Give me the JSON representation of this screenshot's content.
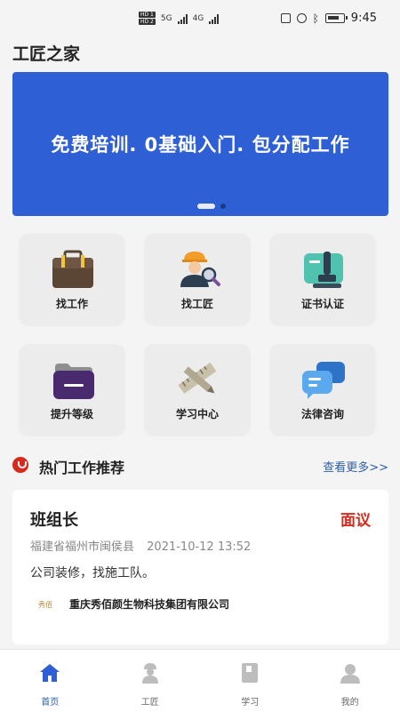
{
  "status_bar": {
    "hd1": "HD 1",
    "hd2": "HD 2",
    "net1": "5G",
    "net2": "4G",
    "time": "9:45"
  },
  "header": {
    "title": "工匠之家"
  },
  "banner": {
    "text": "免费培训. 0基础入门. 包分配工作"
  },
  "menu": [
    {
      "label": "找工作",
      "icon": "briefcase-icon"
    },
    {
      "label": "找工匠",
      "icon": "worker-search-icon"
    },
    {
      "label": "证书认证",
      "icon": "certificate-stamp-icon"
    },
    {
      "label": "提升等级",
      "icon": "folder-icon"
    },
    {
      "label": "学习中心",
      "icon": "ruler-pencil-icon"
    },
    {
      "label": "法律咨询",
      "icon": "chat-bubbles-icon"
    }
  ],
  "section": {
    "title": "热门工作推荐",
    "more": "查看更多>>"
  },
  "job": {
    "title": "班组长",
    "salary": "面议",
    "location": "福建省福州市闽侯县",
    "date": "2021-10-12 13:52",
    "description": "公司装修，找施工队。",
    "company": "重庆秀佰颜生物科技集团有限公司",
    "logo_text": "秀佰"
  },
  "tabs": [
    {
      "label": "首页",
      "icon": "home-icon",
      "active": true
    },
    {
      "label": "工匠",
      "icon": "worker-icon",
      "active": false
    },
    {
      "label": "学习",
      "icon": "book-icon",
      "active": false
    },
    {
      "label": "我的",
      "icon": "user-icon",
      "active": false
    }
  ],
  "colors": {
    "accent": "#2f5fd4",
    "salary": "#d9281c",
    "link": "#2f5fa8"
  }
}
